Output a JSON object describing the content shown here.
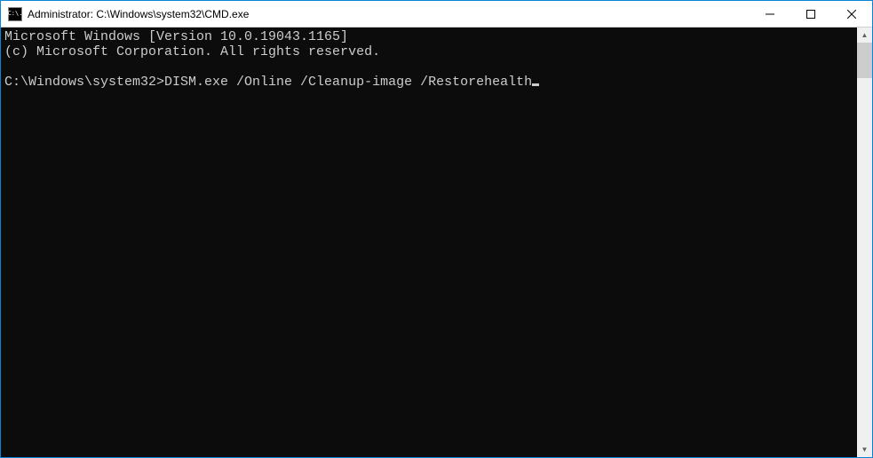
{
  "window": {
    "title": "Administrator: C:\\Windows\\system32\\CMD.exe",
    "icon_text": "C:\\."
  },
  "terminal": {
    "line1": "Microsoft Windows [Version 10.0.19043.1165]",
    "line2": "(c) Microsoft Corporation. All rights reserved.",
    "blank": "",
    "prompt": "C:\\Windows\\system32>",
    "command": "DISM.exe /Online /Cleanup-image /Restorehealth"
  }
}
